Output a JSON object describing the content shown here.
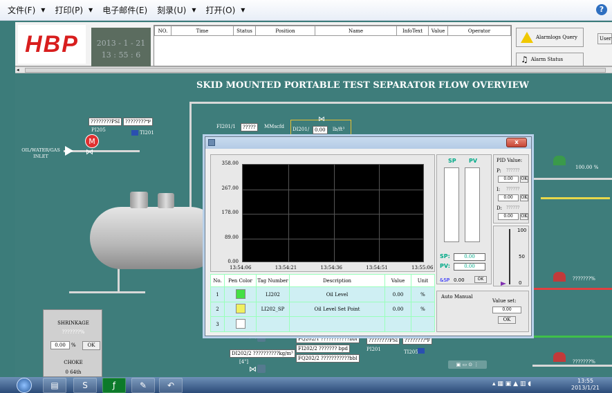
{
  "menu": [
    {
      "label": "文件(F)",
      "arrow": "▼"
    },
    {
      "label": "打印(P)",
      "arrow": "▼"
    },
    {
      "label": "电子邮件(E)",
      "arrow": ""
    },
    {
      "label": "刻录(U)",
      "arrow": "▼"
    },
    {
      "label": "打开(O)",
      "arrow": "▼"
    }
  ],
  "header": {
    "logo": "HBP",
    "date": "2013 - 1 - 21",
    "time": "13 : 55 : 6",
    "alarm_columns": [
      "NO.",
      "Time",
      "Status",
      "Position",
      "Name",
      "InfoText",
      "Value",
      "Operator"
    ],
    "alarm_query": "Alarmlogs Query",
    "alarm_status": "Alarm Status",
    "user_btn": "User"
  },
  "process": {
    "title": "SKID MOUNTED PORTABLE TEST SEPARATOR FLOW OVERVIEW",
    "inlet": "OIL/WATER/GAS INLET",
    "pi205": "PI205",
    "ti201": "TI201",
    "pi205_val": "????????PSI",
    "ti201_val": "????????℉",
    "fi201_1": "FI201/1",
    "fi201_1_val": "?????",
    "fi201_1_unit": "MMscfd",
    "di201": "DI201/",
    "di201_val": "0.00",
    "di201_unit": "lb/ft³",
    "fq202_1": "FQ202/1",
    "fq202_1_val": "???????????bbl",
    "fi202_2": "FI202/2",
    "fi202_2_val": "???????",
    "fi202_2_unit": "bpd",
    "fq202_2": "FQ202/2",
    "fq202_2_val": "???????????bbl",
    "di202_2": "DI202/2",
    "di202_2_val": "??????????kg/m³",
    "size4": "[4\"]",
    "pi201": "PI201",
    "pi201_val": "????????PSI",
    "ti205": "TI205",
    "ti205_val": "????????℉",
    "valve_pct": "100.00 %",
    "valve2_pct": "???????%",
    "valve3_pct": "???????%"
  },
  "shrinkage": {
    "title": "SHRINKAGE",
    "value_q": "???????%",
    "input": "0.00",
    "unit": "%",
    "ok": "OK",
    "choke": "CHOKE",
    "choke_val": "0  64th"
  },
  "dialog": {
    "close": "x",
    "y_ticks": [
      "358.00",
      "267.00",
      "178.00",
      "89.00",
      "0.00"
    ],
    "x_ticks": [
      "13:54:06",
      "13:54:21",
      "13:54:36",
      "13:54:51",
      "13:55:06"
    ],
    "table_headers": [
      "No.",
      "Pen Color",
      "Tag Number",
      "Description",
      "Value",
      "Unit"
    ],
    "rows": [
      {
        "no": "1",
        "color": "#44e044",
        "tag": "LI202",
        "desc": "Oil Level",
        "value": "0.00",
        "unit": "%"
      },
      {
        "no": "2",
        "color": "#f0f060",
        "tag": "LI202_SP",
        "desc": "Oil Level Set Point",
        "value": "0.00",
        "unit": "%"
      },
      {
        "no": "3",
        "color": "#ffffff",
        "tag": "",
        "desc": "",
        "value": "",
        "unit": ""
      }
    ],
    "sp_label": "SP",
    "pv_label": "PV",
    "sp_title": "SP:",
    "pv_title": "PV:",
    "sp_val": "0.00",
    "pv_val": "0.00",
    "asp_label": "&SP",
    "asp_val": "0.00",
    "ok": "OK",
    "pid_title": "PID Value:",
    "p_label": "P:",
    "i_label": "I:",
    "d_label": "D:",
    "pid_q": "??????",
    "pid_val": "0.00",
    "out_100": "100",
    "out_50": "50",
    "out_0": "0",
    "auto_manual": "Auto Manual",
    "value_set": "Value set:",
    "value_set_val": "0.00"
  },
  "taskbar": {
    "time": "13:55",
    "date": "2013/1/21"
  }
}
